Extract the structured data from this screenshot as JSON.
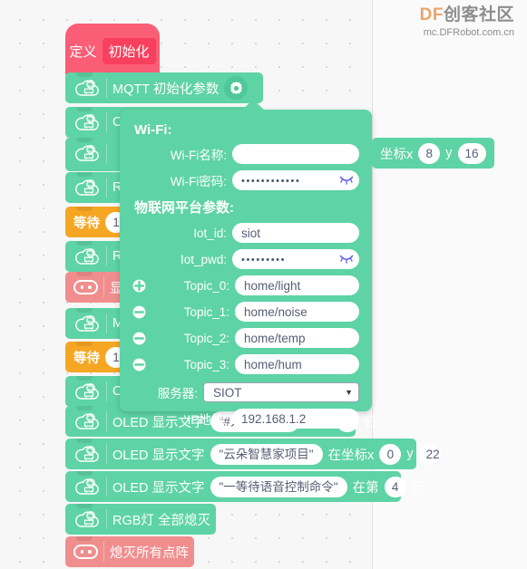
{
  "watermark": {
    "brand_prefix": "DF",
    "brand_suffix": "创客社区",
    "url": "mc.DFRobot.com.cn",
    "brand_prefix_color": "#e8a46a",
    "brand_suffix_color": "#8d8d8d"
  },
  "colors": {
    "green_block": "#5ed3a5",
    "red_block": "#f08e8e",
    "hat_red": "#fa5e76",
    "orange_block": "#f5a623",
    "canvas": "#f7f7f7",
    "field_text": "#575e75"
  },
  "hat_block": {
    "keyword": "定义",
    "name": "初始化"
  },
  "blocks": [
    {
      "id": "mqtt-init",
      "color": "green",
      "label": "MQTT 初始化参数",
      "icon": "cloud-chip-icon",
      "has_gear": true
    },
    {
      "id": "row-b2",
      "color": "green",
      "label": "O",
      "icon": "cloud-chip-icon"
    },
    {
      "id": "row-b3",
      "color": "green",
      "label": "R",
      "icon": "cloud-chip-icon"
    },
    {
      "id": "row-wait1",
      "color": "orange",
      "label": "等待",
      "value": "1"
    },
    {
      "id": "row-b4",
      "color": "green",
      "label": "R",
      "icon": "cloud-chip-icon"
    },
    {
      "id": "row-show",
      "color": "red",
      "label": "显",
      "icon": "microbit-face-icon"
    },
    {
      "id": "row-b5",
      "color": "green",
      "label": "M",
      "icon": "cloud-chip-icon"
    },
    {
      "id": "row-wait2",
      "color": "orange",
      "label": "等待",
      "value": "1"
    },
    {
      "id": "row-b6",
      "color": "green",
      "label": "O",
      "icon": "cloud-chip-icon"
    }
  ],
  "oled_peek_block": {
    "prefix": "坐标x",
    "x": "8",
    "y": "16",
    "y_label": "y"
  },
  "oled_rows": [
    {
      "id": "oled-1",
      "prefix": "OLED 显示文字",
      "text": "\"#人民为本#\"",
      "mid": "在第",
      "num": "1",
      "suffix": "行",
      "icon": "cloud-chip-icon"
    },
    {
      "id": "oled-2",
      "prefix": "OLED 显示文字",
      "text": "\"云朵智慧家项目\"",
      "mid": "在坐标x",
      "num": "0",
      "y_label": "y",
      "ynum": "22",
      "icon": "cloud-chip-icon"
    },
    {
      "id": "oled-3",
      "prefix": "OLED 显示文字",
      "text": "\"一等待语音控制命令\"",
      "mid": "在第",
      "num": "4",
      "suffix": "行",
      "icon": "cloud-chip-icon"
    }
  ],
  "rgb_block": {
    "label": "RGB灯 全部熄灭",
    "icon": "cloud-chip-icon"
  },
  "matrix_block": {
    "label": "熄灭所有点阵",
    "icon": "microbit-face-icon"
  },
  "dialog": {
    "wifi_section_title": "Wi-Fi:",
    "wifi_name_label": "Wi-Fi名称:",
    "wifi_name_value": "",
    "wifi_name_placeholder": "",
    "wifi_pwd_label": "Wi-Fi密码:",
    "wifi_pwd_value": "••••••••••••",
    "iot_section_title": "物联网平台参数:",
    "iot_id_label": "Iot_id:",
    "iot_id_value": "siot",
    "iot_pwd_label": "Iot_pwd:",
    "iot_pwd_value": "•••••••••",
    "topics": [
      {
        "label": "Topic_0:",
        "value": "home/light",
        "btn": "add-icon"
      },
      {
        "label": "Topic_1:",
        "value": "home/noise",
        "btn": "remove-icon"
      },
      {
        "label": "Topic_2:",
        "value": "home/temp",
        "btn": "remove-icon"
      },
      {
        "label": "Topic_3:",
        "value": "home/hum",
        "btn": "remove-icon"
      }
    ],
    "server_label": "服务器:",
    "server_value": "SIOT",
    "server_options": [
      "SIOT"
    ],
    "ip_label": "IP地址:",
    "ip_value": "192.168.1.2"
  }
}
